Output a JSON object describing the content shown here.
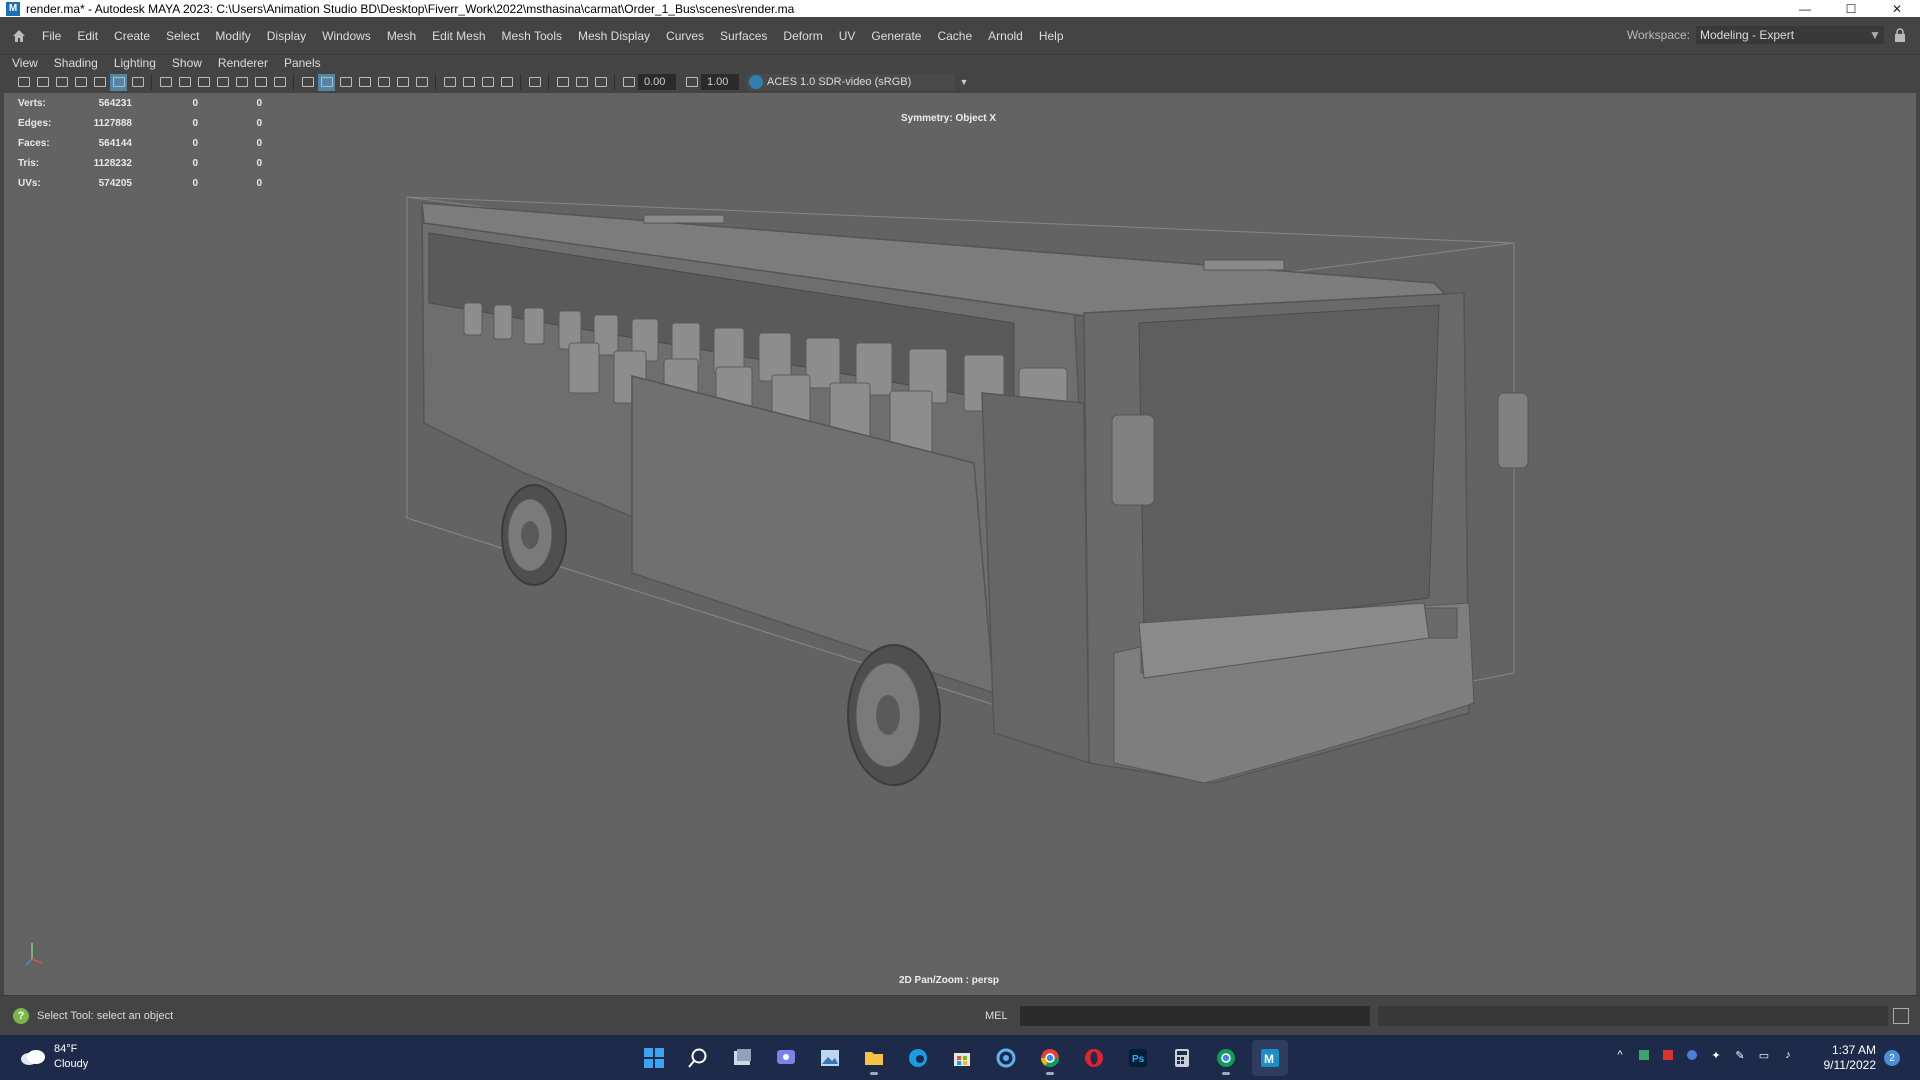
{
  "window": {
    "title": "render.ma* - Autodesk MAYA 2023: C:\\Users\\Animation Studio BD\\Desktop\\Fiverr_Work\\2022\\msthasina\\carmat\\Order_1_Bus\\scenes\\render.ma",
    "minimize": "—",
    "maximize": "☐",
    "close": "✕"
  },
  "menubar": {
    "items": [
      "File",
      "Edit",
      "Create",
      "Select",
      "Modify",
      "Display",
      "Windows",
      "Mesh",
      "Edit Mesh",
      "Mesh Tools",
      "Mesh Display",
      "Curves",
      "Surfaces",
      "Deform",
      "UV",
      "Generate",
      "Cache",
      "Arnold",
      "Help"
    ],
    "workspace_label": "Workspace:",
    "workspace_value": "Modeling - Expert"
  },
  "panel_menu": {
    "items": [
      "View",
      "Shading",
      "Lighting",
      "Show",
      "Renderer",
      "Panels"
    ]
  },
  "panel_toolbar": {
    "exposure": "0.00",
    "gamma": "1.00",
    "color_space": "ACES 1.0 SDR-video (sRGB)"
  },
  "viewport": {
    "stats": [
      {
        "label": "Verts:",
        "v1": "564231",
        "v2": "0",
        "v3": "0"
      },
      {
        "label": "Edges:",
        "v1": "1127888",
        "v2": "0",
        "v3": "0"
      },
      {
        "label": "Faces:",
        "v1": "564144",
        "v2": "0",
        "v3": "0"
      },
      {
        "label": "Tris:",
        "v1": "1128232",
        "v2": "0",
        "v3": "0"
      },
      {
        "label": "UVs:",
        "v1": "574205",
        "v2": "0",
        "v3": "0"
      }
    ],
    "symmetry": "Symmetry: Object X",
    "camera": "2D Pan/Zoom : persp",
    "background_color": "#636363"
  },
  "helpline": {
    "help_text": "Select Tool: select an object",
    "mel_label": "MEL"
  },
  "taskbar": {
    "temperature": "84°F",
    "condition": "Cloudy",
    "time": "1:37 AM",
    "date": "9/11/2022",
    "notifications": "2",
    "apps": [
      "windows-start",
      "search",
      "task-view",
      "teams-chat",
      "photos",
      "file-explorer",
      "edge",
      "microsoft-store",
      "settings",
      "chrome",
      "opera",
      "photoshop",
      "calculator",
      "chrome-profile",
      "maya"
    ]
  },
  "colors": {
    "accent": "#5285a6",
    "taskbar": "#1d2a4a",
    "maya_blue": "#1a6fb5"
  }
}
